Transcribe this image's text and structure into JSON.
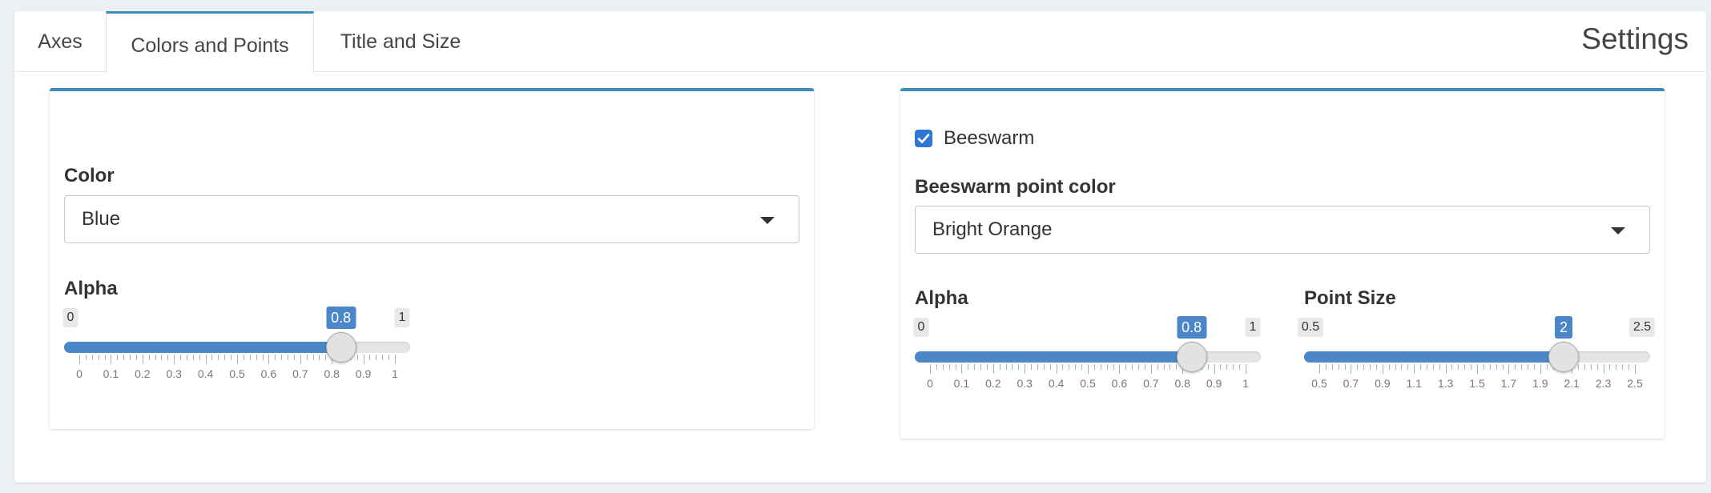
{
  "tabs": [
    {
      "label": "Axes",
      "active": false
    },
    {
      "label": "Colors and Points",
      "active": true
    },
    {
      "label": "Title and Size",
      "active": false
    }
  ],
  "tab_box_title": "Settings",
  "accent_color": "#3c8dbc",
  "left_panel": {
    "color": {
      "label": "Color",
      "selected": "Blue"
    },
    "alpha": {
      "label": "Alpha",
      "min": "0",
      "max": "1",
      "value": 0.8,
      "value_label": "0.8",
      "ticks": [
        "0",
        "0.1",
        "0.2",
        "0.3",
        "0.4",
        "0.5",
        "0.6",
        "0.7",
        "0.8",
        "0.9",
        "1"
      ]
    }
  },
  "right_panel": {
    "beeswarm": {
      "label": "Beeswarm",
      "checked": true
    },
    "point_color": {
      "label": "Beeswarm point color",
      "selected": "Bright Orange"
    },
    "alpha": {
      "label": "Alpha",
      "min": "0",
      "max": "1",
      "value": 0.8,
      "value_label": "0.8",
      "ticks": [
        "0",
        "0.1",
        "0.2",
        "0.3",
        "0.4",
        "0.5",
        "0.6",
        "0.7",
        "0.8",
        "0.9",
        "1"
      ]
    },
    "point_size": {
      "label": "Point Size",
      "min": "0.5",
      "max": "2.5",
      "value": 2,
      "value_label": "2",
      "ticks": [
        "0.5",
        "0.7",
        "0.9",
        "1.1",
        "1.3",
        "1.5",
        "1.7",
        "1.9",
        "2.1",
        "2.3",
        "2.5"
      ]
    }
  }
}
